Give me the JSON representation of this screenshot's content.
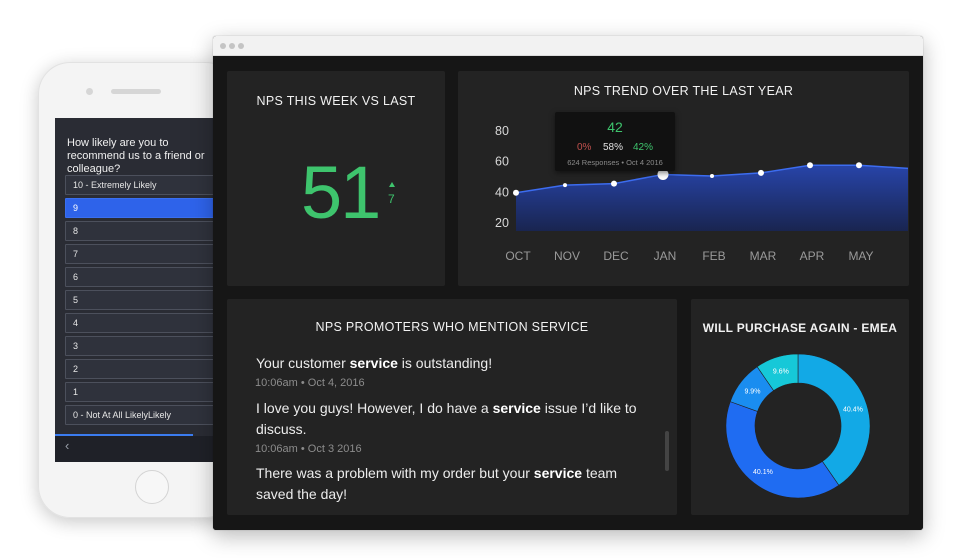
{
  "phone": {
    "question": "How likely are you to recommend us to a friend or colleague?",
    "selected_index": 1,
    "options": [
      "10 - Extremely Likely",
      "9",
      "8",
      "7",
      "6",
      "5",
      "4",
      "3",
      "2",
      "1",
      "0 - Not At All LikelyLikely"
    ],
    "back_icon": "chevron-left-icon",
    "accent": "#2e63ea"
  },
  "dashboard": {
    "nps_week": {
      "title": "NPS THIS WEEK VS LAST",
      "value": "51",
      "delta": "7",
      "trend_icon": "arrow-up-icon",
      "color": "#3ec46d"
    },
    "trend": {
      "title": "NPS TREND OVER THE LAST YEAR",
      "tooltip": {
        "value": "42",
        "detractors": "0%",
        "passives": "58%",
        "promoters": "42%",
        "meta": "624 Responses  •  Oct 4 2016"
      }
    },
    "service": {
      "title": "NPS PROMOTERS WHO MENTION SERVICE",
      "comments": [
        {
          "before": "Your customer ",
          "keyword": "service",
          "after": " is outstanding!",
          "meta": "10:06am • Oct 4, 2016"
        },
        {
          "before": "I love you guys! However, I do have a ",
          "keyword": "service",
          "after": " issue I’d like to discuss.",
          "meta": "10:06am • Oct 3 2016"
        },
        {
          "before": "There was a problem with my order but  your ",
          "keyword": "service",
          "after": " team saved the day!",
          "meta": ""
        }
      ]
    },
    "purchase": {
      "title": "WILL PURCHASE AGAIN - EMEA"
    }
  },
  "chart_data": [
    {
      "type": "area",
      "title": "NPS TREND OVER THE LAST YEAR",
      "categories": [
        "OCT",
        "NOV",
        "DEC",
        "JAN",
        "FEB",
        "MAR",
        "APR",
        "MAY"
      ],
      "x": [
        0,
        1,
        2,
        3,
        4,
        5,
        6,
        7,
        8
      ],
      "values": [
        39,
        44,
        45,
        51,
        50,
        52,
        57,
        57,
        55
      ],
      "yticks": [
        20,
        40,
        60,
        80
      ],
      "ylim": [
        14,
        84
      ],
      "highlight_x": 3,
      "grid": false,
      "line_color": "#3c6cf0"
    },
    {
      "type": "pie",
      "title": "WILL PURCHASE AGAIN - EMEA",
      "labels": [
        "40.4%",
        "40.1%",
        "9.9%",
        "9.6%"
      ],
      "values": [
        40.4,
        40.1,
        9.9,
        9.6
      ],
      "colors": [
        "#12a9e6",
        "#1f6cf2",
        "#1a8df0",
        "#16c8d8"
      ],
      "donut": true
    }
  ]
}
